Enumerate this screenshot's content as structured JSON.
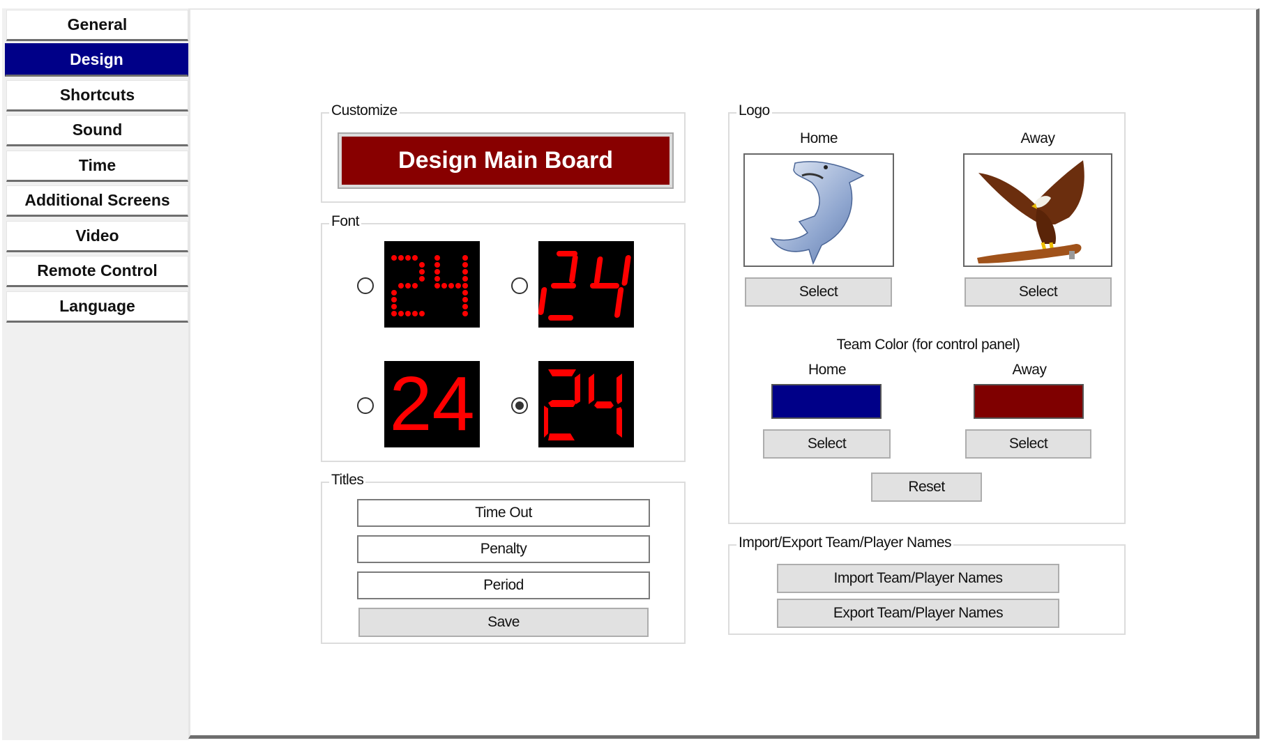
{
  "sidebar": {
    "items": [
      {
        "label": "General",
        "active": false
      },
      {
        "label": "Design",
        "active": true
      },
      {
        "label": "Shortcuts",
        "active": false
      },
      {
        "label": "Sound",
        "active": false
      },
      {
        "label": "Time",
        "active": false
      },
      {
        "label": "Additional Screens",
        "active": false
      },
      {
        "label": "Video",
        "active": false
      },
      {
        "label": "Remote Control",
        "active": false
      },
      {
        "label": "Language",
        "active": false
      }
    ]
  },
  "customize": {
    "title": "Customize",
    "design_main_board_label": "Design Main Board"
  },
  "font": {
    "title": "Font",
    "options": [
      {
        "name": "dot-matrix",
        "sample": "24",
        "selected": false
      },
      {
        "name": "seven-segment-slanted",
        "sample": "24",
        "selected": false
      },
      {
        "name": "plain",
        "sample": "24",
        "selected": false
      },
      {
        "name": "seven-segment",
        "sample": "24",
        "selected": true
      }
    ]
  },
  "titles": {
    "title": "Titles",
    "fields": [
      "Time Out",
      "Penalty",
      "Period"
    ],
    "save_label": "Save"
  },
  "logo": {
    "title": "Logo",
    "home_label": "Home",
    "away_label": "Away",
    "home_logo_icon": "shark-logo",
    "away_logo_icon": "eagle-logo",
    "select_label": "Select"
  },
  "team_color": {
    "title": "Team Color (for control panel)",
    "home_label": "Home",
    "away_label": "Away",
    "home_color": "#000088",
    "away_color": "#7f0000",
    "select_label": "Select",
    "reset_label": "Reset"
  },
  "import_export": {
    "title": "Import/Export Team/Player Names",
    "import_label": "Import Team/Player Names",
    "export_label": "Export Team/Player Names"
  }
}
